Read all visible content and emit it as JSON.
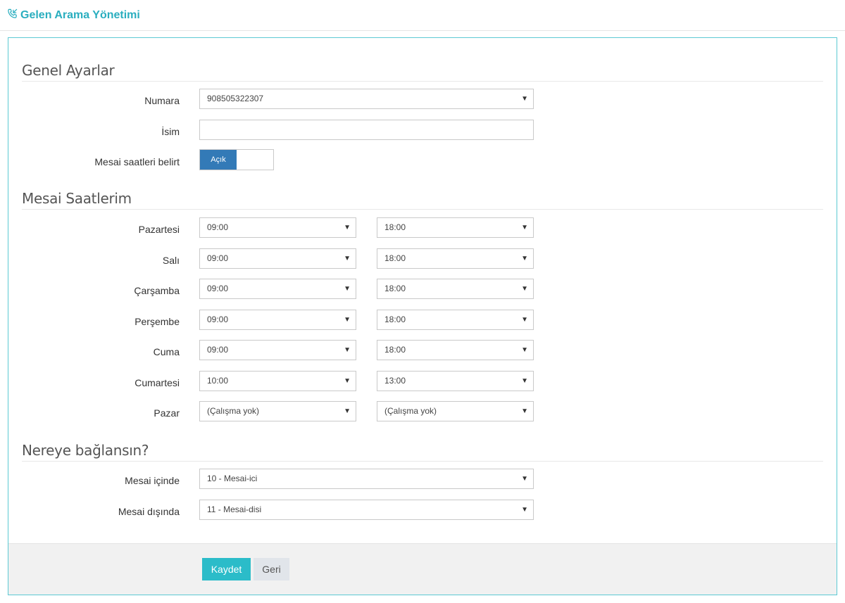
{
  "header": {
    "title": "Gelen Arama Yönetimi",
    "icon": "phone-incoming-icon"
  },
  "general": {
    "title": "Genel Ayarlar",
    "number_label": "Numara",
    "number_value": "908505322307",
    "name_label": "İsim",
    "name_value": "",
    "hours_toggle_label": "Mesai saatleri belirt",
    "hours_toggle_value": "Açık"
  },
  "hours": {
    "title": "Mesai Saatlerim",
    "days": [
      {
        "label": "Pazartesi",
        "start": "09:00",
        "end": "18:00"
      },
      {
        "label": "Salı",
        "start": "09:00",
        "end": "18:00"
      },
      {
        "label": "Çarşamba",
        "start": "09:00",
        "end": "18:00"
      },
      {
        "label": "Perşembe",
        "start": "09:00",
        "end": "18:00"
      },
      {
        "label": "Cuma",
        "start": "09:00",
        "end": "18:00"
      },
      {
        "label": "Cumartesi",
        "start": "10:00",
        "end": "13:00"
      },
      {
        "label": "Pazar",
        "start": "(Çalışma yok)",
        "end": "(Çalışma yok)"
      }
    ]
  },
  "routing": {
    "title": "Nereye bağlansın?",
    "inside_label": "Mesai içinde",
    "inside_value": "10 - Mesai-ici",
    "outside_label": "Mesai dışında",
    "outside_value": "11 - Mesai-disi"
  },
  "actions": {
    "save_label": "Kaydet",
    "back_label": "Geri"
  },
  "colors": {
    "accent": "#2aaebf",
    "toggle_on": "#337ab7",
    "save_button": "#2bbcc9"
  }
}
